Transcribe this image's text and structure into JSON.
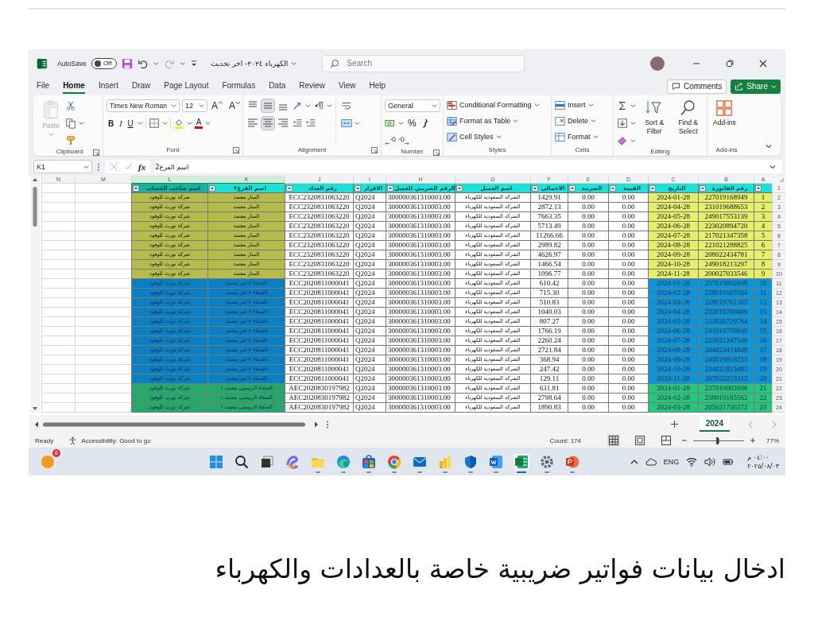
{
  "top_bar": {
    "autosave_label": "AutoSave",
    "autosave": {
      "label": "Off",
      "on": false
    },
    "file_title": "الكهرباء ٢٠٢٤- اخر تحديث",
    "search": {
      "placeholder": "Search"
    }
  },
  "ribbon_tabs": [
    {
      "label": "File",
      "selected": false
    },
    {
      "label": "Home",
      "selected": true
    },
    {
      "label": "Insert",
      "selected": false
    },
    {
      "label": "Draw",
      "selected": false
    },
    {
      "label": "Page Layout",
      "selected": false
    },
    {
      "label": "Formulas",
      "selected": false
    },
    {
      "label": "Data",
      "selected": false
    },
    {
      "label": "Review",
      "selected": false
    },
    {
      "label": "View",
      "selected": false
    },
    {
      "label": "Help",
      "selected": false
    }
  ],
  "comments_button": "Comments",
  "share_button": "Share",
  "ribbon_groups": [
    {
      "kind": "clipboard",
      "label": "Clipboard",
      "paste": {
        "label": "Paste",
        "disabled": true
      }
    },
    {
      "kind": "font",
      "label": "Font",
      "font_name": "Times New Roman",
      "font_size": "12",
      "grow": "A",
      "shrink": "A",
      "bold": "B",
      "italic": "I",
      "underline": "U",
      "font_color": "A"
    },
    {
      "kind": "alignment",
      "label": "Alignment",
      "vertical": [
        {
          "selected": false
        },
        {
          "selected": true
        },
        {
          "selected": false
        }
      ],
      "horizontal": [
        {
          "selected": false
        },
        {
          "selected": true
        },
        {
          "selected": false
        }
      ]
    },
    {
      "kind": "number",
      "label": "Number",
      "format": "General",
      "percent": "%"
    },
    {
      "kind": "styles",
      "label": "Styles",
      "buttons": [
        "Conditional Formatting",
        "Format as Table",
        "Cell Styles"
      ]
    },
    {
      "kind": "cells",
      "label": "Cells",
      "buttons": [
        "Insert",
        "Delete",
        "Format"
      ]
    },
    {
      "kind": "editing",
      "label": "Editing",
      "buttons": [
        "Sort & Filter",
        "Find & Select"
      ]
    },
    {
      "kind": "addins",
      "label": "Add-ins",
      "buttons": [
        "Add-ins"
      ]
    }
  ],
  "formula_bar": {
    "name_box": "K1",
    "fx": "fx",
    "value": "اسم الفرع2"
  },
  "table": {
    "header_row_number": "1",
    "columns": [
      {
        "letter": "N",
        "selected": false
      },
      {
        "letter": "M",
        "selected": false
      },
      {
        "letter": "L",
        "header": "اسم صاحب الحساب",
        "color": "#13b3a4",
        "filter": true,
        "selected": true
      },
      {
        "letter": "K",
        "header": "اسم الفرع٢",
        "color": "#1ee0d8",
        "filter": true,
        "selected": true
      },
      {
        "letter": "J",
        "header": "رقم العداد",
        "color": "#1ee0d8",
        "filter": true,
        "selected": false
      },
      {
        "letter": "I",
        "header": "الاقرار",
        "color": "#1ee0d8",
        "filter": true,
        "selected": false
      },
      {
        "letter": "H",
        "header": "الرقم الضريبي للعميل",
        "color": "#1ee0d8",
        "filter": true,
        "selected": false
      },
      {
        "letter": "G",
        "header": "اسم العميل",
        "color": "#1ee0d8",
        "filter": true,
        "selected": false
      },
      {
        "letter": "F",
        "header": "الاجمالي",
        "color": "#1ee0d8",
        "filter": true,
        "selected": false
      },
      {
        "letter": "E",
        "header": "الضريبة",
        "color": "#1ee0d8",
        "filter": true,
        "selected": false
      },
      {
        "letter": "D",
        "header": "القيمة",
        "color": "#1ee0d8",
        "filter": true,
        "selected": false
      },
      {
        "letter": "C",
        "header": "التاريخ",
        "color": "#1ee0d8",
        "filter": true,
        "selected": false
      },
      {
        "letter": "B",
        "header": "رقم الفاتورة",
        "color": "#1ee0d8",
        "filter": true,
        "selected": false
      },
      {
        "letter": "A",
        "color": "#1ee0d8",
        "filter": true,
        "selected": false
      }
    ],
    "rows": [
      {
        "row_number": "2",
        "color": "#e6ee6b",
        "branch": {
          "color": "#b6bc4b"
        },
        "cells": [
          "",
          "",
          "شركة نورث للوفود",
          "المنار معتمد",
          "ECC2320831063220",
          "Q2024",
          "300000361310003.00",
          "الشركة السعودية للكهرباء",
          "1429.91",
          "0.00",
          "0.00",
          "2024-01-28",
          "227019168949",
          "1"
        ]
      },
      {
        "row_number": "3",
        "color": "#e6ee6b",
        "branch": {
          "color": "#b6bc4b"
        },
        "cells": [
          "",
          "",
          "شركة نورث للوفود",
          "المنار معتمد",
          "ECC2320831063220",
          "Q2024",
          "300000361310003.00",
          "الشركة السعودية للكهرباء",
          "2872.13",
          "0.00",
          "0.00",
          "2024-04-28",
          "231019688653",
          "2"
        ]
      },
      {
        "row_number": "4",
        "color": "#e6ee6b",
        "branch": {
          "color": "#b6bc4b"
        },
        "cells": [
          "",
          "",
          "شركة نورث للوفود",
          "المنار معتمد",
          "ECC2320831063220",
          "Q2024",
          "300000361310003.00",
          "الشركة السعودية للكهرباء",
          "7663.35",
          "0.00",
          "0.00",
          "2024-05-28",
          "249017553139",
          "3"
        ]
      },
      {
        "row_number": "5",
        "color": "#e6ee6b",
        "branch": {
          "color": "#b6bc4b"
        },
        "cells": [
          "",
          "",
          "شركة نورث للوفود",
          "المنار معتمد",
          "ECC2320831063220",
          "Q2024",
          "300000361310003.00",
          "الشركة السعودية للكهرباء",
          "5713.49",
          "0.00",
          "0.00",
          "2024-06-28",
          "223020894720",
          "4"
        ]
      },
      {
        "row_number": "6",
        "color": "#e6ee6b",
        "branch": {
          "color": "#b6bc4b"
        },
        "cells": [
          "",
          "",
          "شركة نورث للوفود",
          "المنار معتمد",
          "ECC2320831063220",
          "Q2024",
          "300000361310003.00",
          "الشركة السعودية للكهرباء",
          "11266.66",
          "0.00",
          "0.00",
          "2024-07-28",
          "217021347358",
          "5"
        ]
      },
      {
        "row_number": "7",
        "color": "#e6ee6b",
        "branch": {
          "color": "#b6bc4b"
        },
        "cells": [
          "",
          "",
          "شركة نورث للوفود",
          "المنار معتمد",
          "ECC2320831063220",
          "Q2024",
          "300000361310003.00",
          "الشركة السعودية للكهرباء",
          "2989.82",
          "0.00",
          "0.00",
          "2024-08-28",
          "221021288825",
          "6"
        ]
      },
      {
        "row_number": "8",
        "color": "#e6ee6b",
        "branch": {
          "color": "#b6bc4b"
        },
        "cells": [
          "",
          "",
          "شركة نورث للوفود",
          "المنار معتمد",
          "ECC2320831063220",
          "Q2024",
          "300000361310003.00",
          "الشركة السعودية للكهرباء",
          "4626.97",
          "0.00",
          "0.00",
          "2024-09-28",
          "208022434781",
          "7"
        ]
      },
      {
        "row_number": "9",
        "color": "#e6ee6b",
        "branch": {
          "color": "#b6bc4b"
        },
        "cells": [
          "",
          "",
          "شركة نورث للوفود",
          "المنار معتمد",
          "ECC2320831063220",
          "Q2024",
          "300000361310003.00",
          "الشركة السعودية للكهرباء",
          "1466.54",
          "0.00",
          "0.00",
          "2024-10-28",
          "249018213297",
          "8"
        ]
      },
      {
        "row_number": "10",
        "color": "#e6ee6b",
        "branch": {
          "color": "#b6bc4b"
        },
        "cells": [
          "",
          "",
          "شركة نورث للوفود",
          "المنار معتمد",
          "ECC2320831063220",
          "Q2024",
          "300000361310003.00",
          "الشركة السعودية للكهرباء",
          "1096.77",
          "0.00",
          "0.00",
          "2024-11-28",
          "200027033546",
          "9"
        ]
      },
      {
        "row_number": "11",
        "color": "#0b95d6",
        "branch": {
          "color": "#0a80c2"
        },
        "cells": [
          "",
          "",
          "شركة نورث للوفود",
          "الصفاء ٢ غير معتمد",
          "ECC2020811000041",
          "Q2024",
          "300000361310003.00",
          "الشركة السعودية للكهرباء",
          "610.42",
          "0.00",
          "0.00",
          "2024-01-28",
          "237019002608",
          "10"
        ]
      },
      {
        "row_number": "12",
        "color": "#0b95d6",
        "branch": {
          "color": "#0a80c2"
        },
        "cells": [
          "",
          "",
          "شركة نورث للوفود",
          "الصفاء ٢ غير معتمد",
          "ECC2020811000041",
          "Q2024",
          "300000361310003.00",
          "الشركة السعودية للكهرباء",
          "715.30",
          "0.00",
          "0.00",
          "2024-02-28",
          "238019165564",
          "11"
        ]
      },
      {
        "row_number": "13",
        "color": "#0b95d6",
        "branch": {
          "color": "#0a80c2"
        },
        "cells": [
          "",
          "",
          "شركة نورث للوفود",
          "الصفاء ٢ غير معتمد",
          "ECC2020811000041",
          "Q2024",
          "300000361310003.00",
          "الشركة السعودية للكهرباء",
          "510.83",
          "0.00",
          "0.00",
          "2024-03-28",
          "228019761365",
          "12"
        ]
      },
      {
        "row_number": "14",
        "color": "#0b95d6",
        "branch": {
          "color": "#0a80c2"
        },
        "cells": [
          "",
          "",
          "شركة نورث للوفود",
          "الصفاء ٢ غير معتمد",
          "ECC2020811000041",
          "Q2024",
          "300000361310003.00",
          "الشركة السعودية للكهرباء",
          "1040.03",
          "0.00",
          "0.00",
          "2024-04-28",
          "232019790409",
          "13"
        ]
      },
      {
        "row_number": "15",
        "color": "#0b95d6",
        "branch": {
          "color": "#0a80c2"
        },
        "cells": [
          "",
          "",
          "شركة نورث للوفود",
          "الصفاء ٢ غير معتمد",
          "ECC2020811000041",
          "Q2024",
          "300000361310003.00",
          "الشركة السعودية للكهرباء",
          "807.27",
          "0.00",
          "0.00",
          "2024-05-28",
          "222020729764",
          "14"
        ]
      },
      {
        "row_number": "16",
        "color": "#0b95d6",
        "branch": {
          "color": "#0a80c2"
        },
        "cells": [
          "",
          "",
          "شركة نورث للوفود",
          "الصفاء ٢ غير معتمد",
          "ECC2020811000041",
          "Q2024",
          "300000361310003.00",
          "الشركة السعودية للكهرباء",
          "1766.19",
          "0.00",
          "0.00",
          "2024-06-28",
          "241019759849",
          "15"
        ]
      },
      {
        "row_number": "17",
        "color": "#0b95d6",
        "branch": {
          "color": "#0a80c2"
        },
        "cells": [
          "",
          "",
          "شركة نورث للوفود",
          "الصفاء ٢ غير معتمد",
          "ECC2020811000041",
          "Q2024",
          "300000361310003.00",
          "الشركة السعودية للكهرباء",
          "2260.24",
          "0.00",
          "0.00",
          "2024-07-28",
          "223021247346",
          "16"
        ]
      },
      {
        "row_number": "18",
        "color": "#0b95d6",
        "branch": {
          "color": "#0a80c2"
        },
        "cells": [
          "",
          "",
          "شركة نورث للوفود",
          "الصفاء ٢ غير معتمد",
          "ECC2020811000041",
          "Q2024",
          "300000361310003.00",
          "الشركة السعودية للكهرباء",
          "2721.84",
          "0.00",
          "0.00",
          "2024-08-28",
          "204023414848",
          "17"
        ]
      },
      {
        "row_number": "19",
        "color": "#0b95d6",
        "branch": {
          "color": "#0a80c2"
        },
        "cells": [
          "",
          "",
          "شركة نورث للوفود",
          "الصفاء ٢ غير معتمد",
          "ECC2020811000041",
          "Q2024",
          "300000361310003.00",
          "الشركة السعودية للكهرباء",
          "368.94",
          "0.00",
          "0.00",
          "2024-09-28",
          "245019818233",
          "18"
        ]
      },
      {
        "row_number": "20",
        "color": "#0b95d6",
        "branch": {
          "color": "#0a80c2"
        },
        "cells": [
          "",
          "",
          "شركة نورث للوفود",
          "الصفاء ٢ غير معتمد",
          "ECC2020811000041",
          "Q2024",
          "300000361310003.00",
          "الشركة السعودية للكهرباء",
          "247.42",
          "0.00",
          "0.00",
          "2024-10-28",
          "224021813482",
          "19"
        ]
      },
      {
        "row_number": "21",
        "color": "#0b95d6",
        "branch": {
          "color": "#0a80c2"
        },
        "cells": [
          "",
          "",
          "شركة نورث للوفود",
          "الصفاء ٢ غير معتمد",
          "ECC2020811000041",
          "Q2024",
          "300000361310003.00",
          "الشركة السعودية للكهرباء",
          "129.11",
          "0.00",
          "0.00",
          "2024-11-28",
          "207023229313",
          "20"
        ]
      },
      {
        "row_number": "22",
        "color": "#26c67d",
        "branch": {
          "color": "#25a86a"
        },
        "cells": [
          "",
          "",
          "شركة نورث للوفود",
          "الصفاء الرييسي معتمد ١",
          "AEC2020830197982",
          "Q2024",
          "300000361310003.00",
          "الشركة السعودية للكهرباء",
          "631.81",
          "0.00",
          "0.00",
          "2024-01-28",
          "237019002606",
          "21"
        ]
      },
      {
        "row_number": "23",
        "color": "#26c67d",
        "branch": {
          "color": "#25a86a"
        },
        "cells": [
          "",
          "",
          "شركة نورث للوفود",
          "الصفاء الرييسي معتمد ١",
          "AEC2020830197982",
          "Q2024",
          "300000361310003.00",
          "الشركة السعودية للكهرباء",
          "2798.64",
          "0.00",
          "0.00",
          "2024-02-28",
          "238019165562",
          "22"
        ]
      },
      {
        "row_number": "24",
        "color": "#26c67d",
        "branch": {
          "color": "#25a86a"
        },
        "cells": [
          "",
          "",
          "شركة نورث للوفود",
          "الصفاء الرييسي معتمد ١",
          "AEC2020830197982",
          "Q2024",
          "300000361310003.00",
          "الشركة السعودية للكهرباء",
          "1890.83",
          "0.00",
          "0.00",
          "2024-03-28",
          "205021736372",
          "23"
        ]
      }
    ]
  },
  "sheet_tabs": [
    {
      "label": "2024",
      "selected": true
    }
  ],
  "status_bar": {
    "mode": "Ready",
    "accessibility": "Accessibility: Good to go",
    "count": "Count: 174",
    "views": [
      {
        "selected": true
      },
      {
        "selected": false
      },
      {
        "selected": false
      }
    ],
    "zoom": {
      "level": 0.47,
      "reading": "77%"
    }
  },
  "taskbar": {
    "notification_count": "6",
    "apps": [
      {
        "kind": "start",
        "running": false,
        "active": false
      },
      {
        "kind": "search",
        "running": false,
        "active": false
      },
      {
        "kind": "taskview",
        "running": false,
        "active": false
      },
      {
        "kind": "copilot",
        "running": false,
        "active": false
      },
      {
        "kind": "folder",
        "running": true,
        "active": false
      },
      {
        "kind": "browser",
        "running": true,
        "active": false
      },
      {
        "kind": "store",
        "running": true,
        "active": false
      },
      {
        "kind": "ring",
        "running": true,
        "active": false
      },
      {
        "kind": "mail",
        "running": true,
        "active": false
      },
      {
        "kind": "bars",
        "running": true,
        "active": false
      },
      {
        "kind": "shield",
        "running": true,
        "active": false
      },
      {
        "kind": "doc",
        "running": true,
        "active": false
      },
      {
        "kind": "sheet",
        "running": true,
        "active": true
      },
      {
        "kind": "gear",
        "running": true,
        "active": false
      },
      {
        "kind": "slides",
        "running": true,
        "active": false
      }
    ],
    "language": "ENG",
    "time": "٠٤:٠٠ م",
    "date": "٢٠٢٥/٠٨/٠٣"
  },
  "caption": "ادخال بيانات فواتير ضريبية خاصة بالعدادات والكهرباء"
}
